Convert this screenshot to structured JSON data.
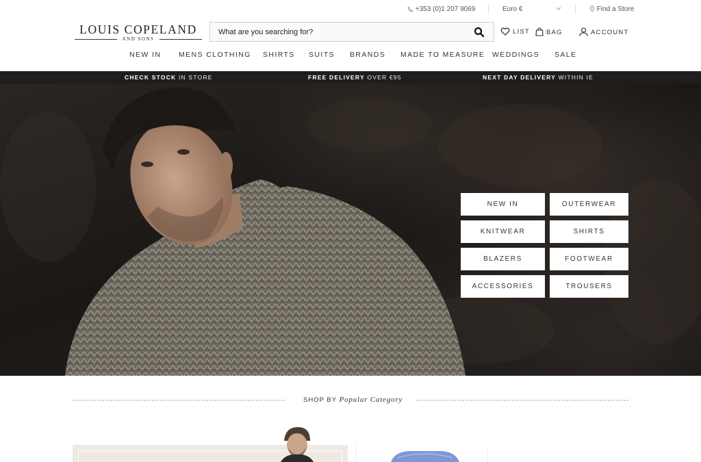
{
  "utility": {
    "phone": "+353 (0)1 207 9069",
    "currency": "Euro €",
    "find_store": "Find a Store"
  },
  "logo": {
    "main": "LOUIS COPELAND",
    "sub": "AND SONS"
  },
  "search": {
    "placeholder": "What are you searching for?"
  },
  "header_links": {
    "list": "LIST",
    "bag": "BAG",
    "account": "ACCOUNT"
  },
  "nav": [
    "NEW IN",
    "MENS CLOTHING",
    "SHIRTS",
    "SUITS",
    "BRANDS",
    "MADE TO MEASURE",
    "WEDDINGS",
    "SALE"
  ],
  "promo": [
    {
      "bold": "CHECK STOCK",
      "rest": "IN STORE"
    },
    {
      "bold": "FREE DELIVERY",
      "rest": "OVER €95"
    },
    {
      "bold": "NEXT DAY DELIVERY",
      "rest": "WITHIN IE"
    }
  ],
  "hero_categories": [
    "NEW IN",
    "OUTERWEAR",
    "KNITWEAR",
    "SHIRTS",
    "BLAZERS",
    "FOOTWEAR",
    "ACCESSORIES",
    "TROUSERS"
  ],
  "shop_by": {
    "prefix": "SHOP BY",
    "emphasis": "Popular Category"
  },
  "colors": {
    "promo_bg": "#1e1e1e",
    "sweater": "#6f6a60",
    "rock": "#1f1b18"
  }
}
